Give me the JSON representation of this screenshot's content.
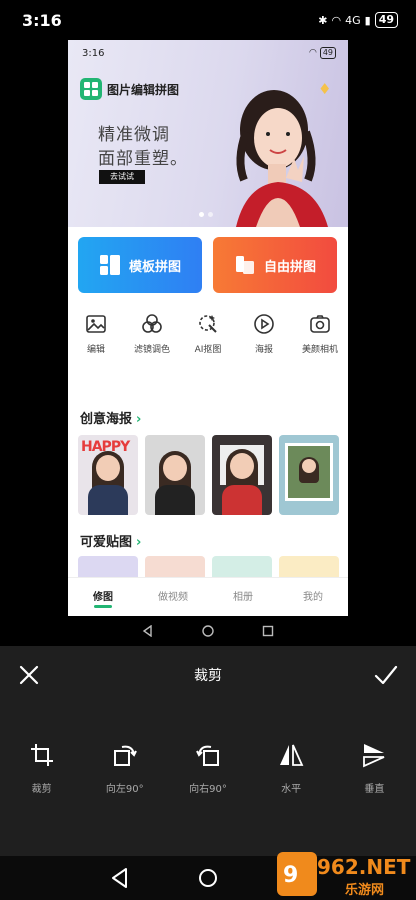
{
  "status": {
    "time": "3:16",
    "battery": "49",
    "network": "4G"
  },
  "preview": {
    "status_time": "3:16",
    "status_battery": "49",
    "app_name": "图片编辑拼图",
    "banner": {
      "line1": "精准微调",
      "line2": "面部重塑。",
      "button": "去试试"
    },
    "buttons": {
      "template": "模板拼图",
      "free": "自由拼图"
    },
    "tools": [
      {
        "label": "编辑",
        "icon": "image-icon"
      },
      {
        "label": "滤镜调色",
        "icon": "filter-icon"
      },
      {
        "label": "AI抠图",
        "icon": "ai-cutout-icon"
      },
      {
        "label": "海报",
        "icon": "play-icon"
      },
      {
        "label": "美颜相机",
        "icon": "camera-icon"
      }
    ],
    "section_posters": "创意海报",
    "poster_happy_text": "HAPPY",
    "section_stickers": "可爱贴图",
    "tabs": [
      "修图",
      "做视频",
      "相册",
      "我的"
    ]
  },
  "editor": {
    "title": "裁剪",
    "tools": [
      {
        "label": "裁剪",
        "icon": "crop-icon"
      },
      {
        "label": "向左90°",
        "icon": "rotate-left-icon"
      },
      {
        "label": "向右90°",
        "icon": "rotate-right-icon"
      },
      {
        "label": "水平",
        "icon": "flip-horizontal-icon"
      },
      {
        "label": "垂直",
        "icon": "flip-vertical-icon"
      }
    ]
  },
  "watermark": {
    "brand": "962.NET",
    "sub": "乐游网"
  },
  "colors": {
    "accent": "#22b573",
    "template_btn": "#2f7ff3",
    "free_btn": "#f24b3f",
    "editor_bg": "#1f1f1f"
  }
}
